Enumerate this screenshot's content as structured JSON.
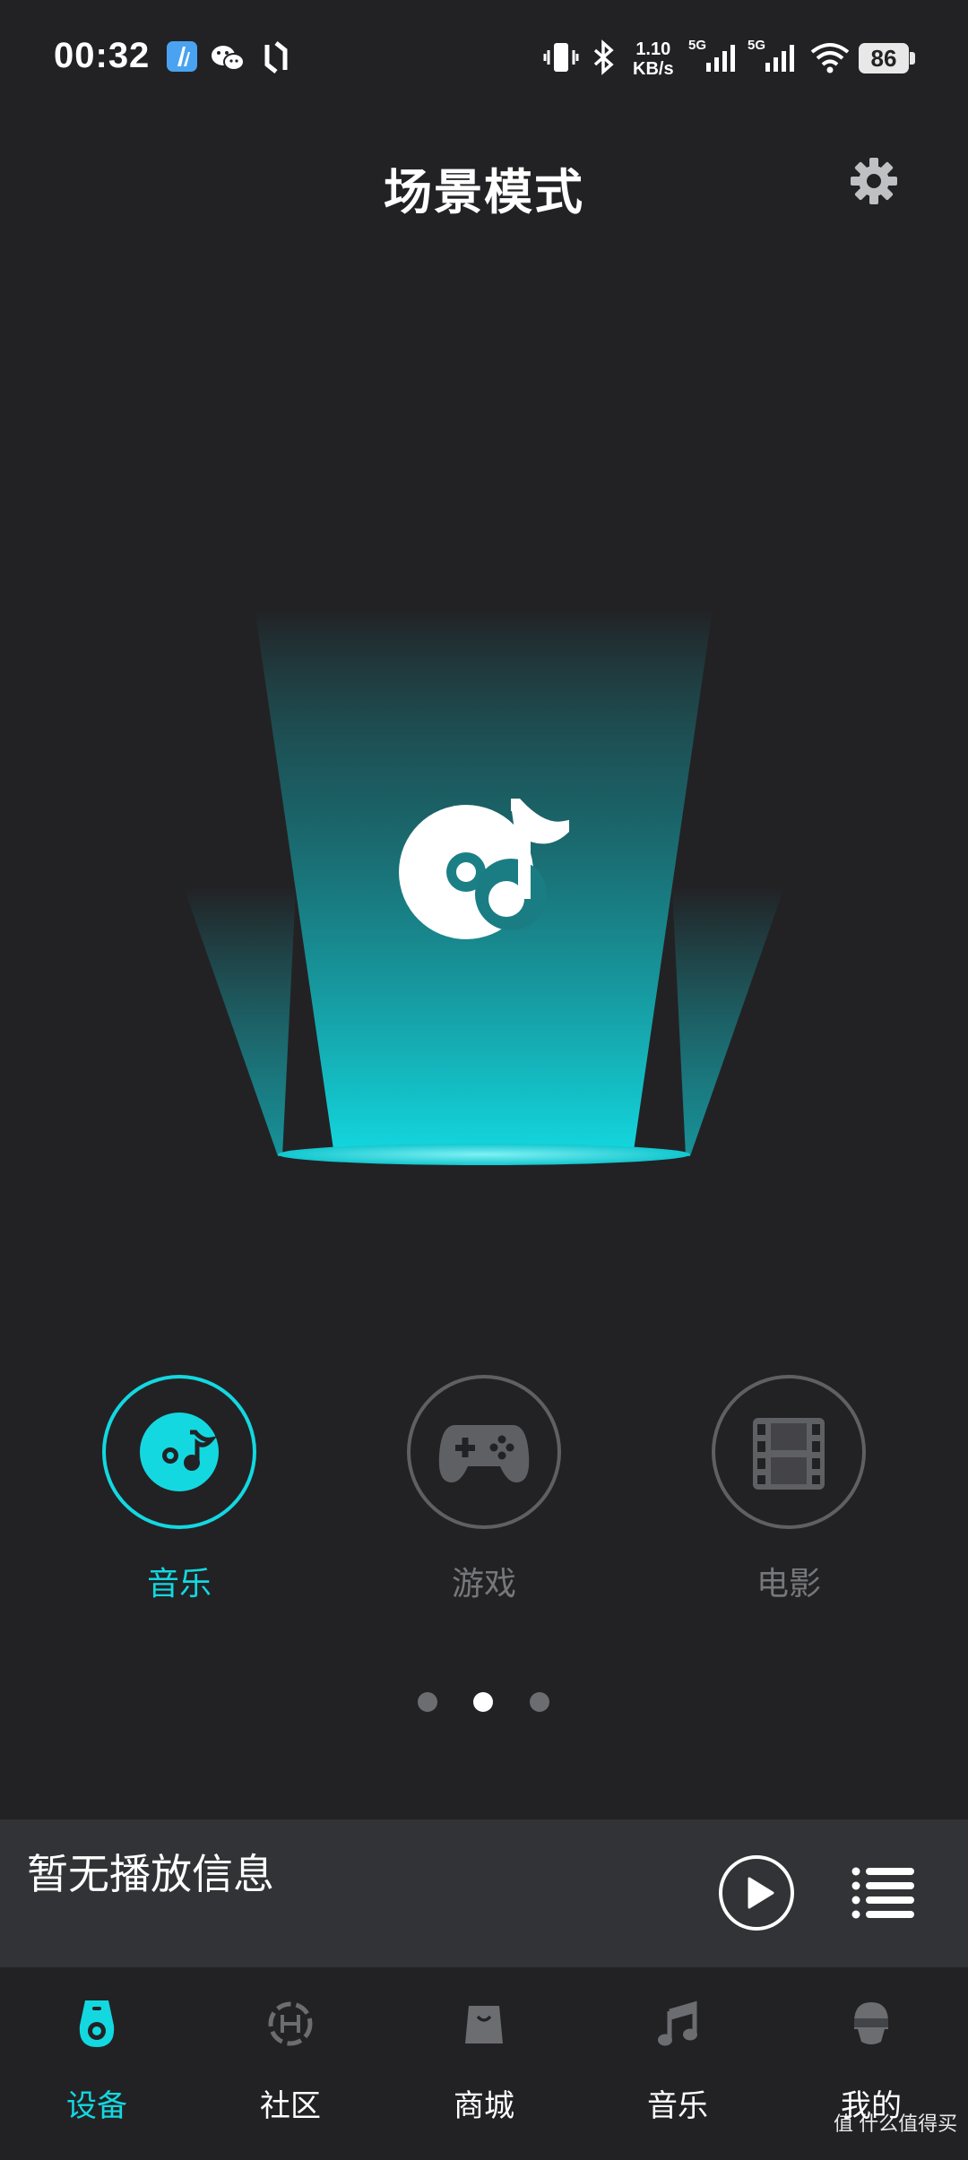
{
  "status_bar": {
    "time": "00:32",
    "net_speed_value": "1.10",
    "net_speed_unit": "KB/s",
    "sim1": "5G",
    "sim2": "5G",
    "battery": "86"
  },
  "header": {
    "title": "场景模式"
  },
  "modes": [
    {
      "label": "音乐",
      "icon": "music-disc-icon",
      "active": true
    },
    {
      "label": "游戏",
      "icon": "gamepad-icon",
      "active": false
    },
    {
      "label": "电影",
      "icon": "film-icon",
      "active": false
    }
  ],
  "pager": {
    "count": 3,
    "active_index": 1
  },
  "player": {
    "now_playing": "暂无播放信息"
  },
  "bottom_nav": [
    {
      "label": "设备",
      "icon": "speaker-icon",
      "active": true
    },
    {
      "label": "社区",
      "icon": "community-icon",
      "active": false
    },
    {
      "label": "商城",
      "icon": "shopping-bag-icon",
      "active": false
    },
    {
      "label": "音乐",
      "icon": "music-note-icon",
      "active": false
    },
    {
      "label": "我的",
      "icon": "profile-helmet-icon",
      "active": false
    }
  ],
  "watermark": "值 什么值得买",
  "colors": {
    "accent": "#13d8e0",
    "background": "#222225",
    "player_bar": "#323336"
  }
}
